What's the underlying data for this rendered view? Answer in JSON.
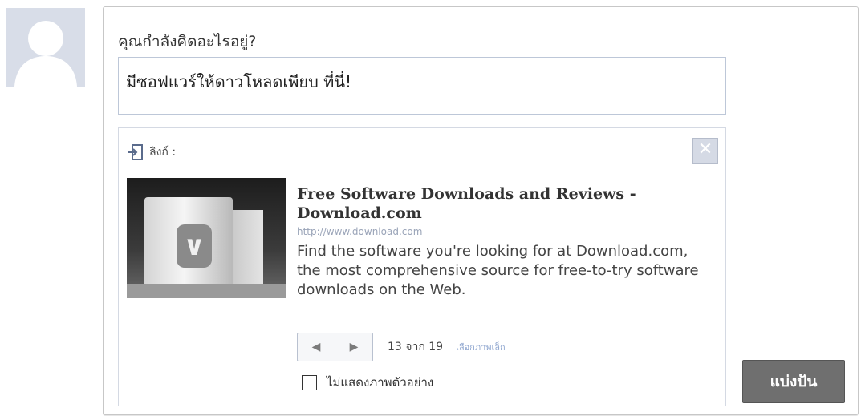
{
  "composer": {
    "prompt": "คุณกำลังคิดอะไรอยู่?",
    "status_text": "มีซอฟแวร์ให้ดาวโหลดเพียบ ที่นี่!",
    "share_label": "แบ่งปัน"
  },
  "attachment": {
    "header_label": "ลิงก์ :",
    "close_label": "✕",
    "title": "Free Software Downloads and Reviews - Download.com",
    "url": "http://www.download.com",
    "description": "Find the software you're looking for at Download.com, the most comprehensive source for free-to-try software downloads on the Web.",
    "pager": {
      "prev": "◀",
      "next": "▶",
      "count": "13 จาก 19",
      "choose_label": "เลือกภาพเล็ก"
    },
    "no_thumbnail_label": "ไม่แสดงภาพตัวอย่าง",
    "no_thumbnail_checked": false
  },
  "icons": [
    "avatar-silhouette",
    "link-icon",
    "close-icon",
    "prev-arrow-icon",
    "next-arrow-icon",
    "download-logo"
  ],
  "colors": {
    "avatar_bg": "#d8dde8",
    "input_border": "#bdc7d8",
    "share_button": "#6f6f6f",
    "link_muted": "#9aa4b8"
  }
}
